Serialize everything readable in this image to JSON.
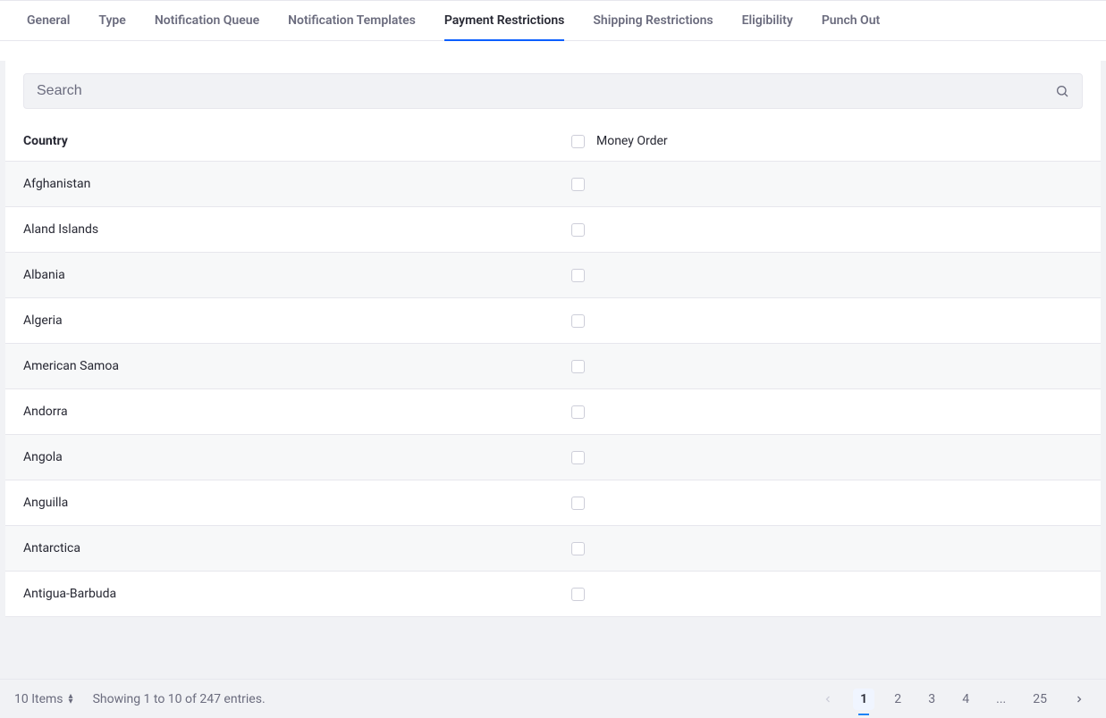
{
  "tabs": [
    {
      "label": "General",
      "active": false
    },
    {
      "label": "Type",
      "active": false
    },
    {
      "label": "Notification Queue",
      "active": false
    },
    {
      "label": "Notification Templates",
      "active": false
    },
    {
      "label": "Payment Restrictions",
      "active": true
    },
    {
      "label": "Shipping Restrictions",
      "active": false
    },
    {
      "label": "Eligibility",
      "active": false
    },
    {
      "label": "Punch Out",
      "active": false
    }
  ],
  "search": {
    "placeholder": "Search",
    "value": ""
  },
  "table": {
    "columns": {
      "country": "Country",
      "money_order": "Money Order"
    },
    "rows": [
      {
        "country": "Afghanistan",
        "money_order_checked": false
      },
      {
        "country": "Aland Islands",
        "money_order_checked": false
      },
      {
        "country": "Albania",
        "money_order_checked": false
      },
      {
        "country": "Algeria",
        "money_order_checked": false
      },
      {
        "country": "American Samoa",
        "money_order_checked": false
      },
      {
        "country": "Andorra",
        "money_order_checked": false
      },
      {
        "country": "Angola",
        "money_order_checked": false
      },
      {
        "country": "Anguilla",
        "money_order_checked": false
      },
      {
        "country": "Antarctica",
        "money_order_checked": false
      },
      {
        "country": "Antigua-Barbuda",
        "money_order_checked": false
      }
    ]
  },
  "footer": {
    "items_per_page": "10 Items",
    "showing": "Showing 1 to 10 of 247 entries.",
    "pages": [
      "1",
      "2",
      "3",
      "4"
    ],
    "ellipsis": "...",
    "last_page": "25",
    "current_page": "1"
  }
}
